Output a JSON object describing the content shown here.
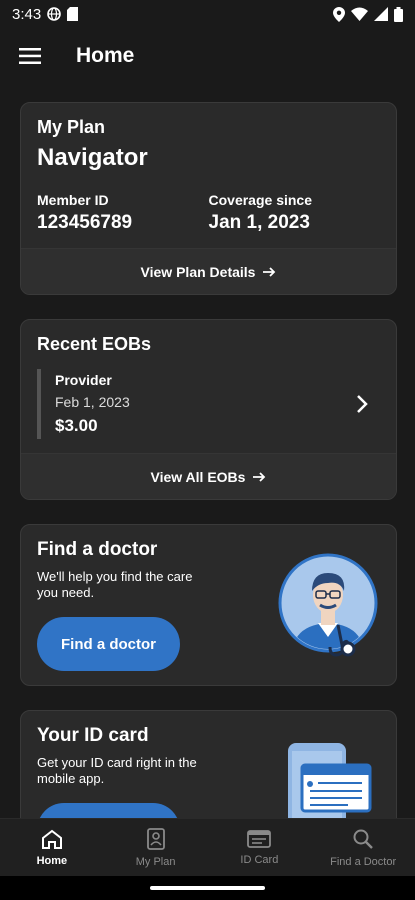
{
  "status": {
    "time": "3:43"
  },
  "app_bar": {
    "title": "Home"
  },
  "plan": {
    "label": "My Plan",
    "name": "Navigator",
    "member_id_label": "Member ID",
    "member_id": "123456789",
    "coverage_label": "Coverage since",
    "coverage_date": "Jan 1, 2023",
    "details_link": "View Plan Details"
  },
  "eobs": {
    "title": "Recent EOBs",
    "items": [
      {
        "provider": "Provider",
        "date": "Feb 1, 2023",
        "amount": "$3.00"
      }
    ],
    "view_all": "View All EOBs"
  },
  "find_doctor": {
    "title": "Find a doctor",
    "description": "We'll help you find the care you need.",
    "button": "Find a doctor"
  },
  "id_card": {
    "title": "Your ID card",
    "description": "Get your ID card right in the mobile app."
  },
  "bottom_nav": {
    "items": [
      {
        "label": "Home",
        "icon": "home-icon",
        "active": true
      },
      {
        "label": "My Plan",
        "icon": "plan-icon",
        "active": false
      },
      {
        "label": "ID Card",
        "icon": "id-card-icon",
        "active": false
      },
      {
        "label": "Find a Doctor",
        "icon": "search-doctor-icon",
        "active": false
      }
    ]
  },
  "colors": {
    "accent": "#3074c6",
    "background": "#1a1a1a",
    "card": "#2a2a2a"
  }
}
